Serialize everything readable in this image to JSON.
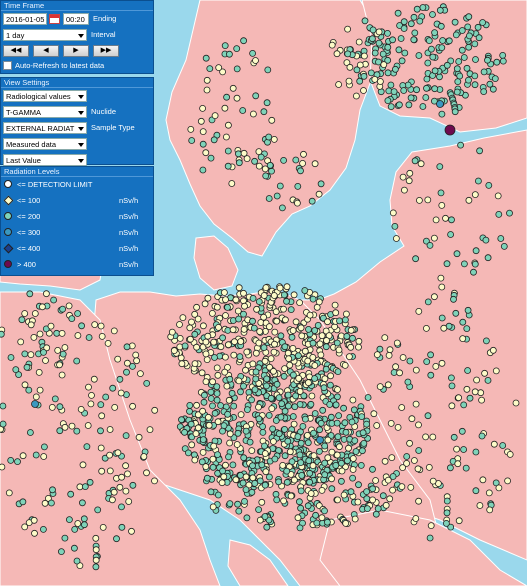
{
  "time_frame": {
    "title": "Time Frame",
    "date": "2016-01-05",
    "time": "00:20",
    "ending_label": "Ending",
    "interval": "1 day",
    "interval_label": "Interval",
    "nav_buttons": [
      "◀◀",
      "◀",
      "▶",
      "▶▶"
    ],
    "auto_refresh_label": "Auto-Refresh to latest data"
  },
  "view_settings": {
    "title": "View Settings",
    "values_select": "Radiological values",
    "nuclide_select": "T-GAMMA",
    "nuclide_label": "Nuclide",
    "sample_select": "EXTERNAL RADIAT",
    "sample_label": "Sample Type",
    "data_select": "Measured data",
    "value_select": "Last Value"
  },
  "legend": {
    "title": "Radiation Levels",
    "items": [
      {
        "label": "<= DETECTION LIMIT",
        "unit": "",
        "color": "#ffffff"
      },
      {
        "label": "<= 100",
        "unit": "nSv/h",
        "color": "#fdfbc8"
      },
      {
        "label": "<= 200",
        "unit": "nSv/h",
        "color": "#7fd3b9"
      },
      {
        "label": "<= 300",
        "unit": "nSv/h",
        "color": "#3a98c0"
      },
      {
        "label": "<= 400",
        "unit": "nSv/h",
        "color": "#1c3f8c"
      },
      {
        "label": ">  400",
        "unit": "nSv/h",
        "color": "#6e0b4e"
      }
    ]
  },
  "colors": {
    "sea": "#9ad8ec",
    "land": "#f5b8b6",
    "border": "#ffffff",
    "panel": "#1571c0"
  }
}
